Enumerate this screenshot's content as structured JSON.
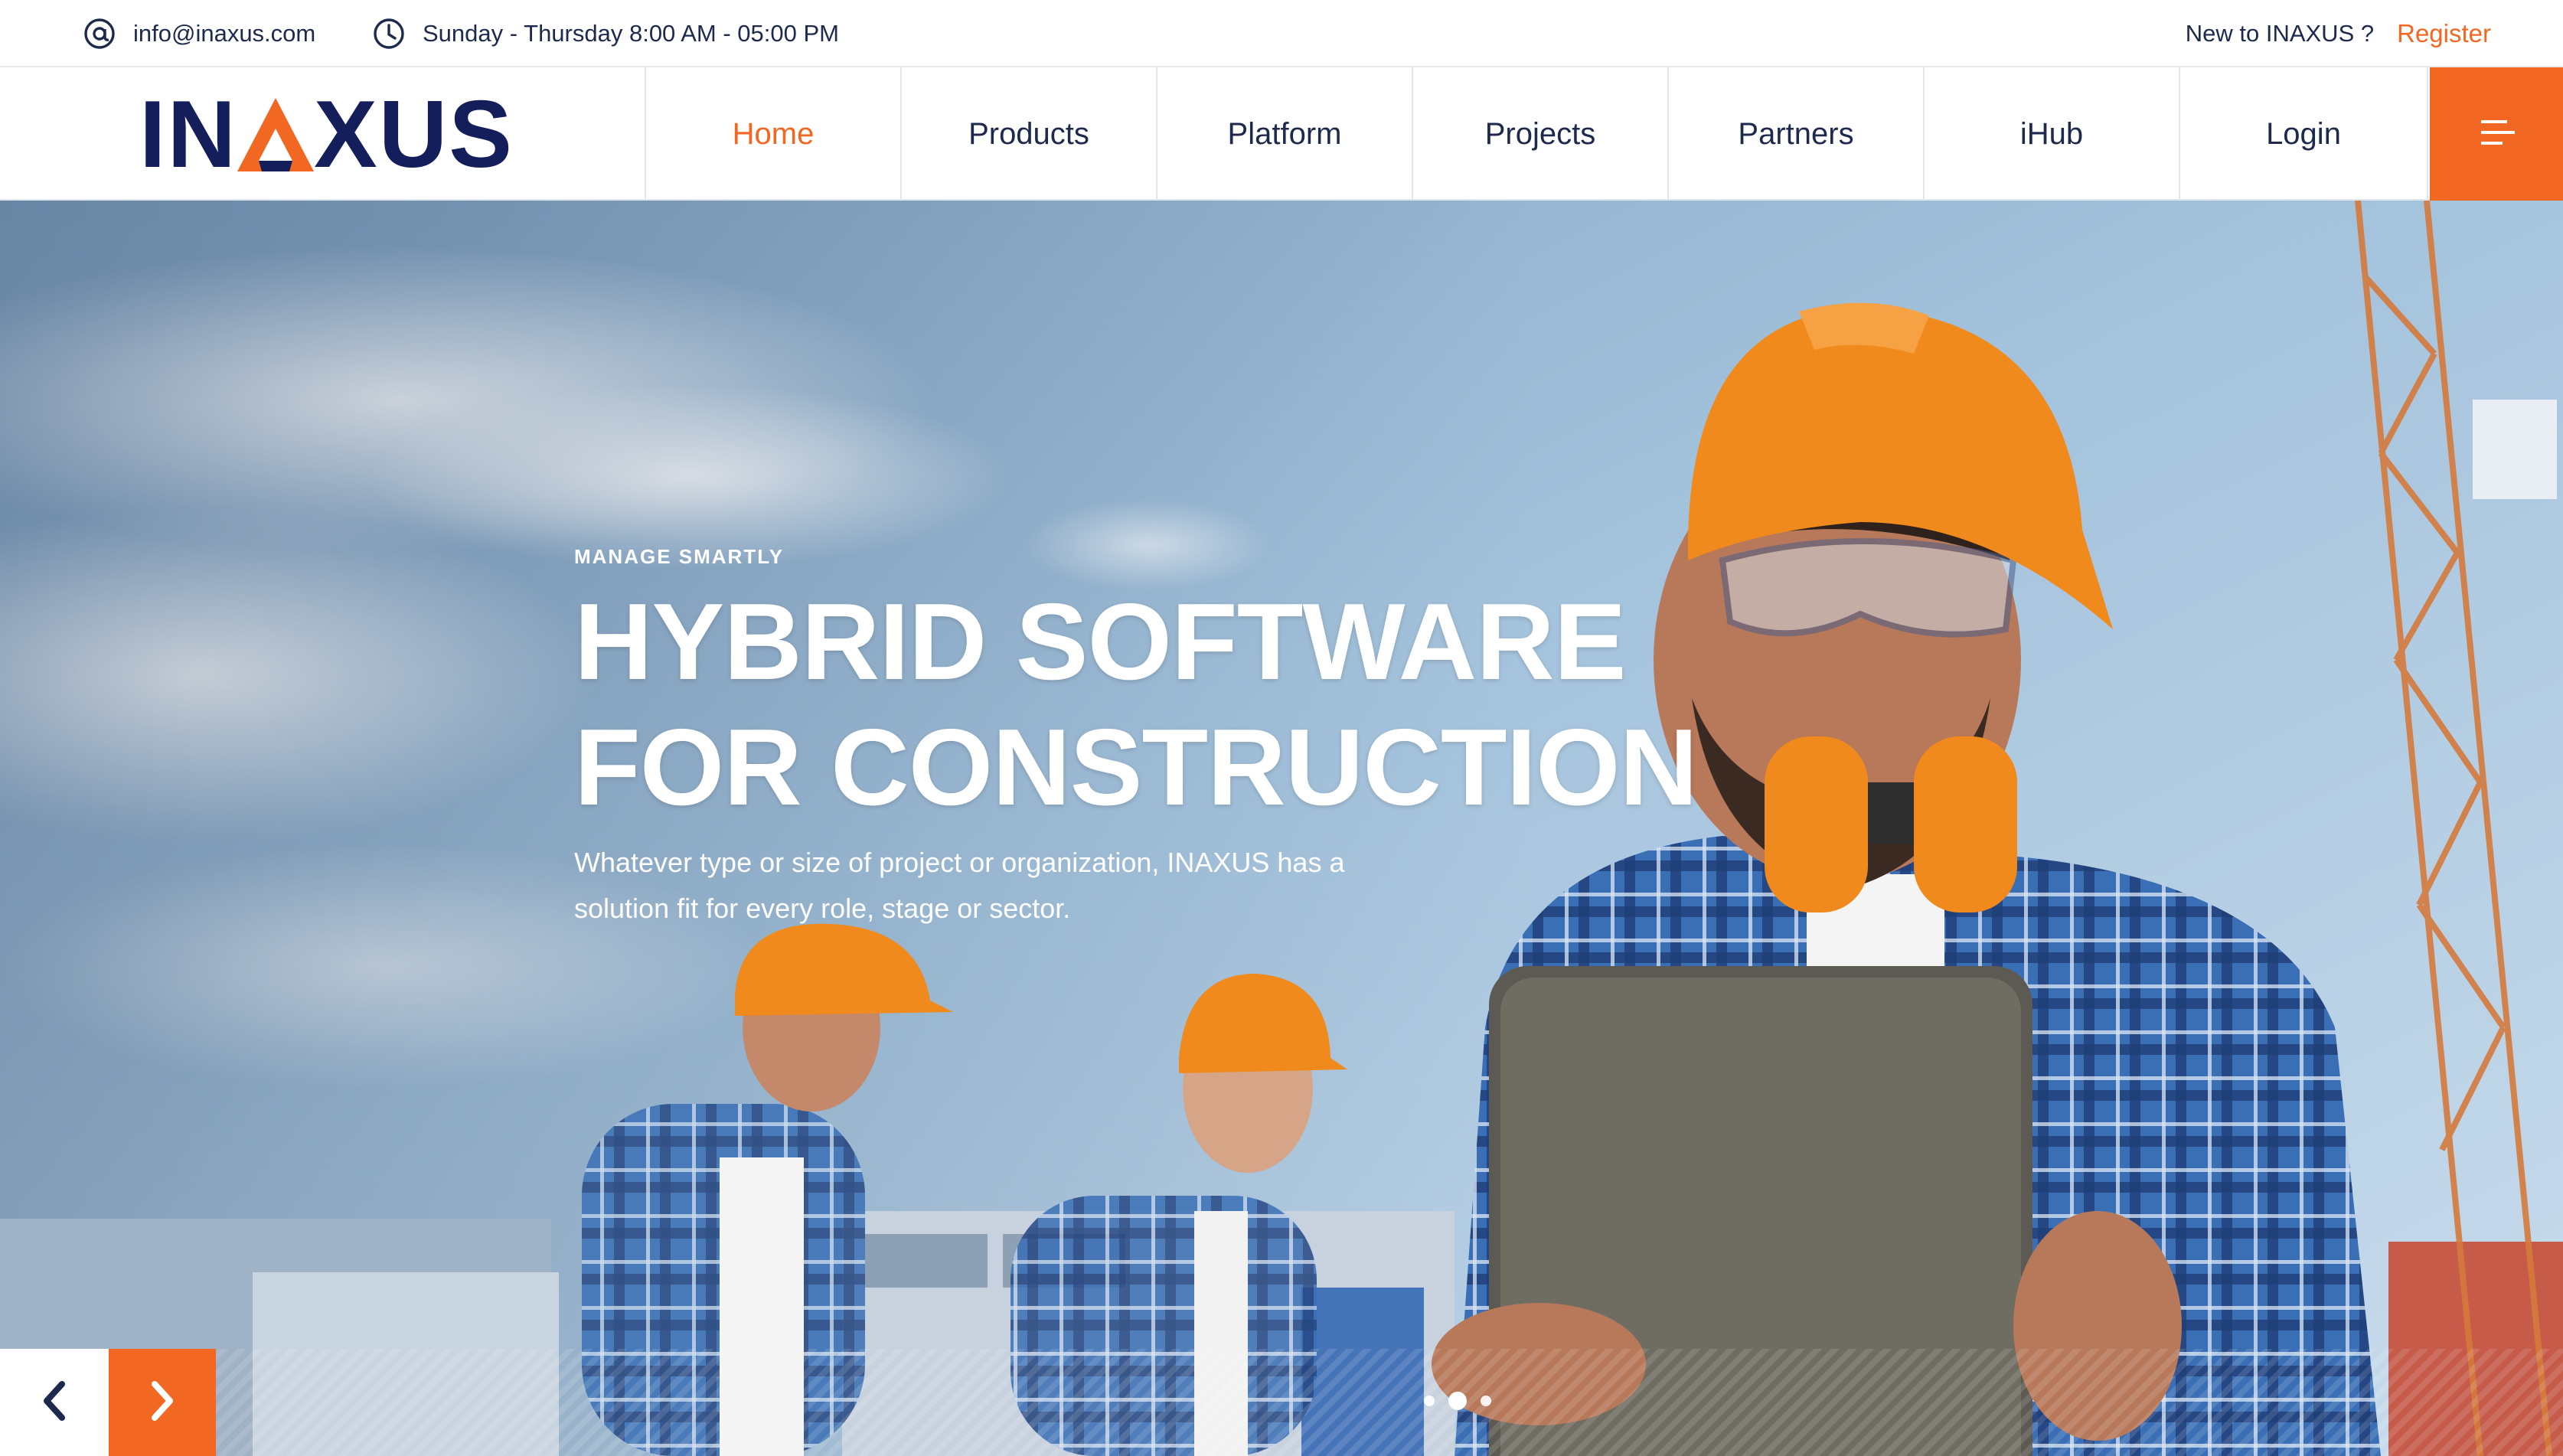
{
  "topbar": {
    "email": "info@inaxus.com",
    "hours": "Sunday - Thursday 8:00 AM - 05:00 PM",
    "new_prompt": "New to INAXUS ?",
    "register": "Register"
  },
  "logo": {
    "left": "IN",
    "right": "XUS",
    "full": "INAXUS"
  },
  "nav": {
    "items": [
      "Home",
      "Products",
      "Platform",
      "Projects",
      "Partners",
      "iHub"
    ],
    "active": "Home",
    "login": "Login"
  },
  "hero": {
    "eyebrow": "MANAGE SMARTLY",
    "headline_line1": "HYBRID SOFTWARE",
    "headline_line2": "FOR CONSTRUCTION",
    "subtitle": "Whatever type or size of project or organization, INAXUS has a solution fit for every role, stage or sector.",
    "slides_total": 3,
    "slide_active": 2
  },
  "colors": {
    "accent": "#f26722",
    "navy": "#141e5a",
    "text": "#1d2a4d"
  },
  "icons": {
    "email": "at-sign-icon",
    "hours": "clock-icon",
    "menu": "hamburger-menu-icon",
    "prev": "chevron-left-icon",
    "next": "chevron-right-icon"
  }
}
